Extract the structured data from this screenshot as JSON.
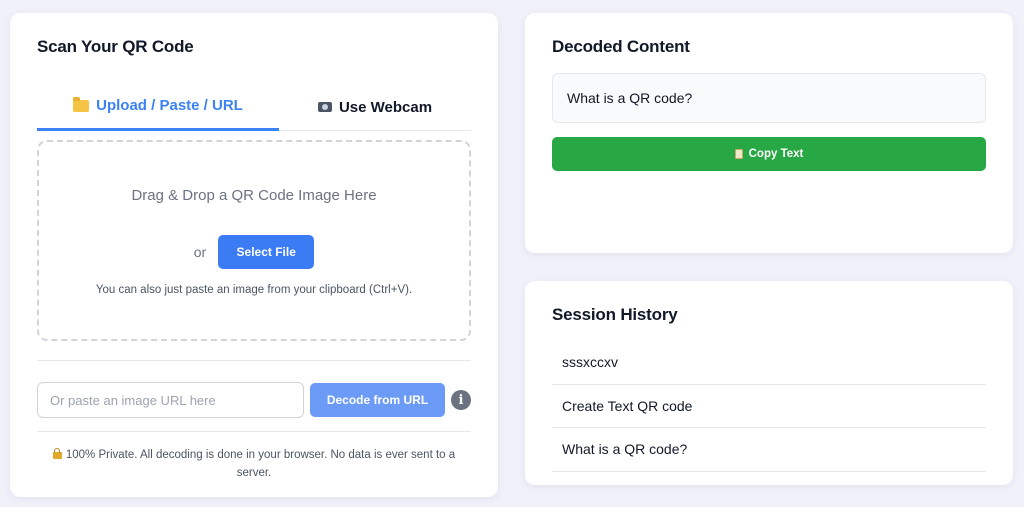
{
  "scan": {
    "title": "Scan Your QR Code",
    "tabs": [
      {
        "label": "Upload / Paste / URL",
        "icon": "folder-icon",
        "active": true
      },
      {
        "label": "Use Webcam",
        "icon": "camera-icon",
        "active": false
      }
    ],
    "dropzone": {
      "text": "Drag & Drop a QR Code Image Here",
      "or": "or",
      "select_button": "Select File",
      "clipboard_hint": "You can also just paste an image from your clipboard (Ctrl+V)."
    },
    "url": {
      "placeholder": "Or paste an image URL here",
      "value": "",
      "decode_button": "Decode from URL",
      "info_icon": "i"
    },
    "privacy": "100% Private. All decoding is done in your browser. No data is ever sent to a server."
  },
  "decoded": {
    "title": "Decoded Content",
    "content": "What is a QR code?",
    "copy_button": "Copy Text"
  },
  "history": {
    "title": "Session History",
    "items": [
      "sssxccxv",
      "Create Text QR code",
      "What is a QR code?"
    ]
  },
  "colors": {
    "accent": "#3b82f6",
    "copy_green": "#28a745",
    "background": "#f1f1fa"
  }
}
